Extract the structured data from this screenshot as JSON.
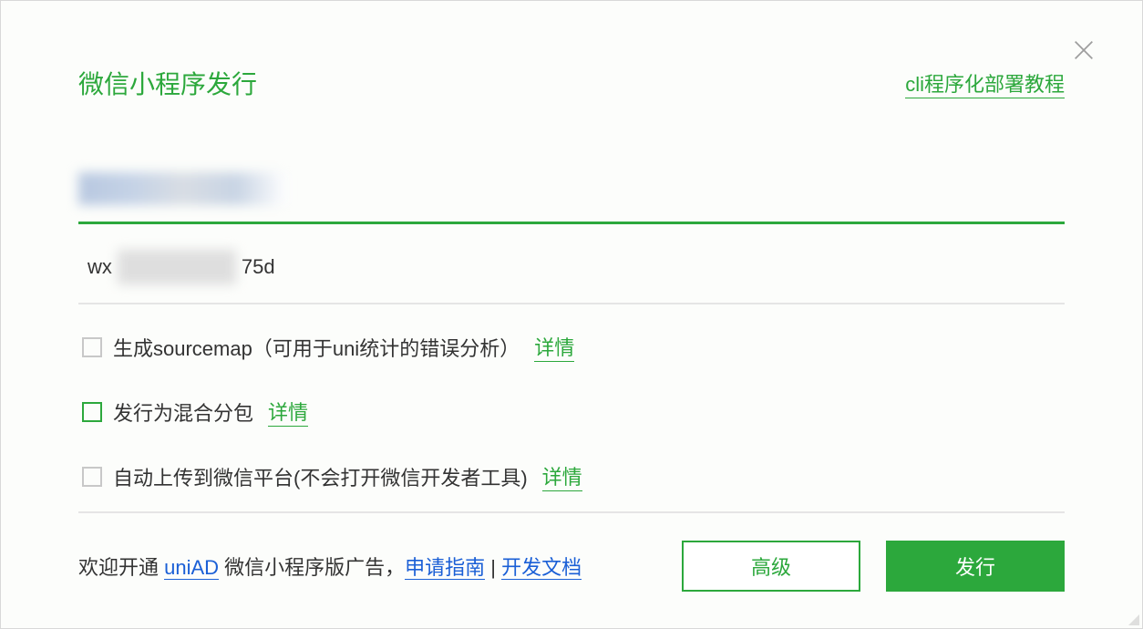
{
  "dialog": {
    "title": "微信小程序发行",
    "tutorial_link": "cli程序化部署教程"
  },
  "appid": {
    "prefix": "wx",
    "suffix": "75d"
  },
  "checkboxes": {
    "sourcemap": {
      "label": "生成sourcemap（可用于uni统计的错误分析）",
      "detail": "详情"
    },
    "hybrid": {
      "label": "发行为混合分包",
      "detail": "详情"
    },
    "auto_upload": {
      "label": "自动上传到微信平台(不会打开微信开发者工具)",
      "detail": "详情"
    }
  },
  "footer": {
    "welcome_prefix": "欢迎开通 ",
    "uniad": "uniAD",
    "welcome_mid": " 微信小程序版广告，",
    "apply_guide": "申请指南",
    "separator": " | ",
    "dev_docs": "开发文档",
    "btn_advanced": "高级",
    "btn_publish": "发行"
  }
}
